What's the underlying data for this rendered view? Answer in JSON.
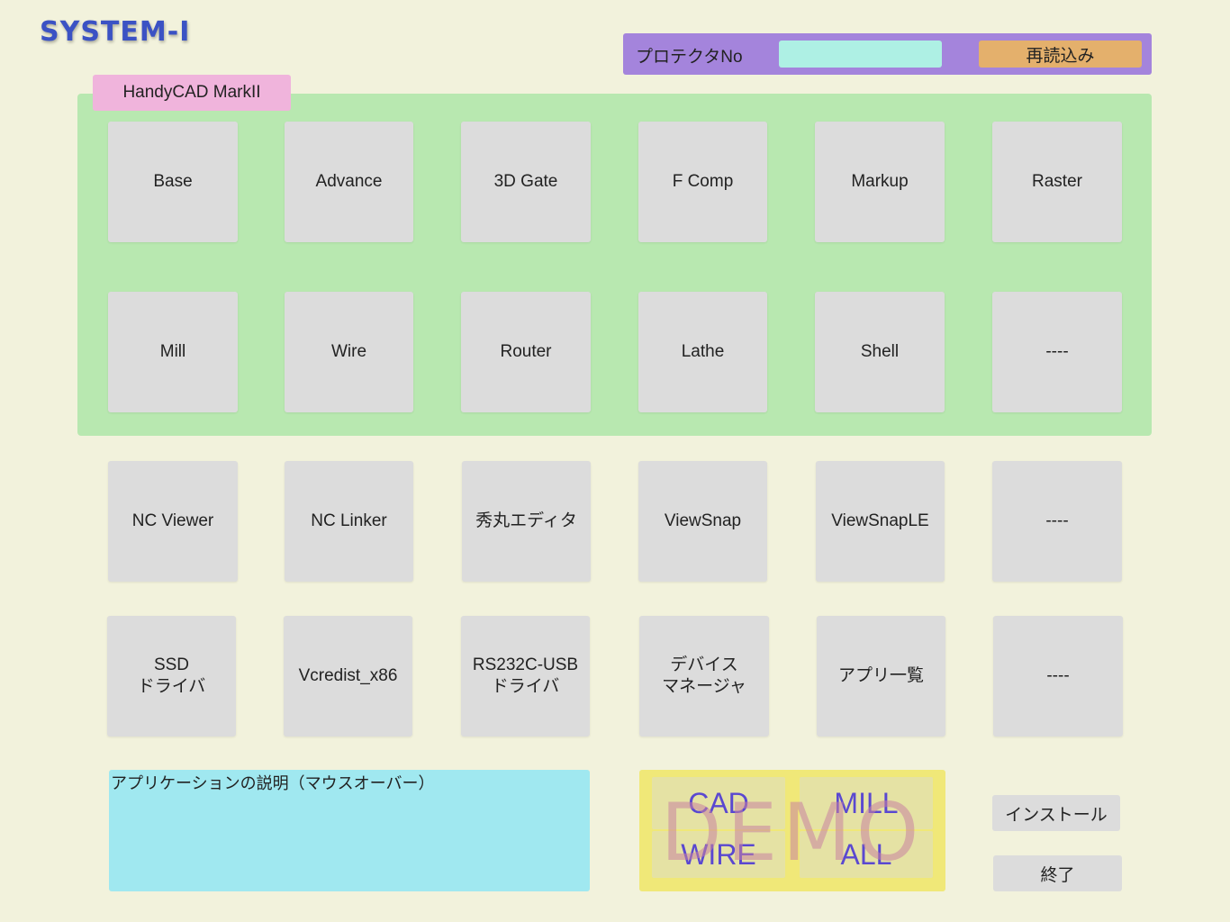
{
  "app": {
    "title": "SYSTEM-I"
  },
  "protector": {
    "label": "プロテクタNo",
    "value": "",
    "reload_label": "再読込み"
  },
  "group": {
    "label": "HandyCAD MarkII"
  },
  "cad_tiles": [
    "Base",
    "Advance",
    "3D Gate",
    "F Comp",
    "Markup",
    "Raster",
    "Mill",
    "Wire",
    "Router",
    "Lathe",
    "Shell",
    "----"
  ],
  "tool_tiles": [
    "NC Viewer",
    "NC Linker",
    "秀丸エディタ",
    "ViewSnap",
    "ViewSnapLE",
    "----"
  ],
  "util_tiles": [
    "SSD\nドライバ",
    "Vcredist_x86",
    "RS232C-USB\nドライバ",
    "デバイス\nマネージャ",
    "アプリ一覧",
    "----"
  ],
  "description": {
    "text": "アプリケーションの説明（マウスオーバー）"
  },
  "demo": {
    "watermark": "DEMO",
    "buttons": [
      "CAD",
      "MILL",
      "WIRE",
      "ALL"
    ]
  },
  "actions": {
    "install_label": "インストール",
    "exit_label": "終了"
  },
  "colors": {
    "background": "#f2f2dc",
    "title": "#3b52c4",
    "protector_bar": "#a484dc",
    "panel": "#b8e8b0",
    "tab": "#f0b4dc",
    "tile": "#dcdcdc",
    "description": "#a0e8f0",
    "demo": "#f0e878"
  }
}
